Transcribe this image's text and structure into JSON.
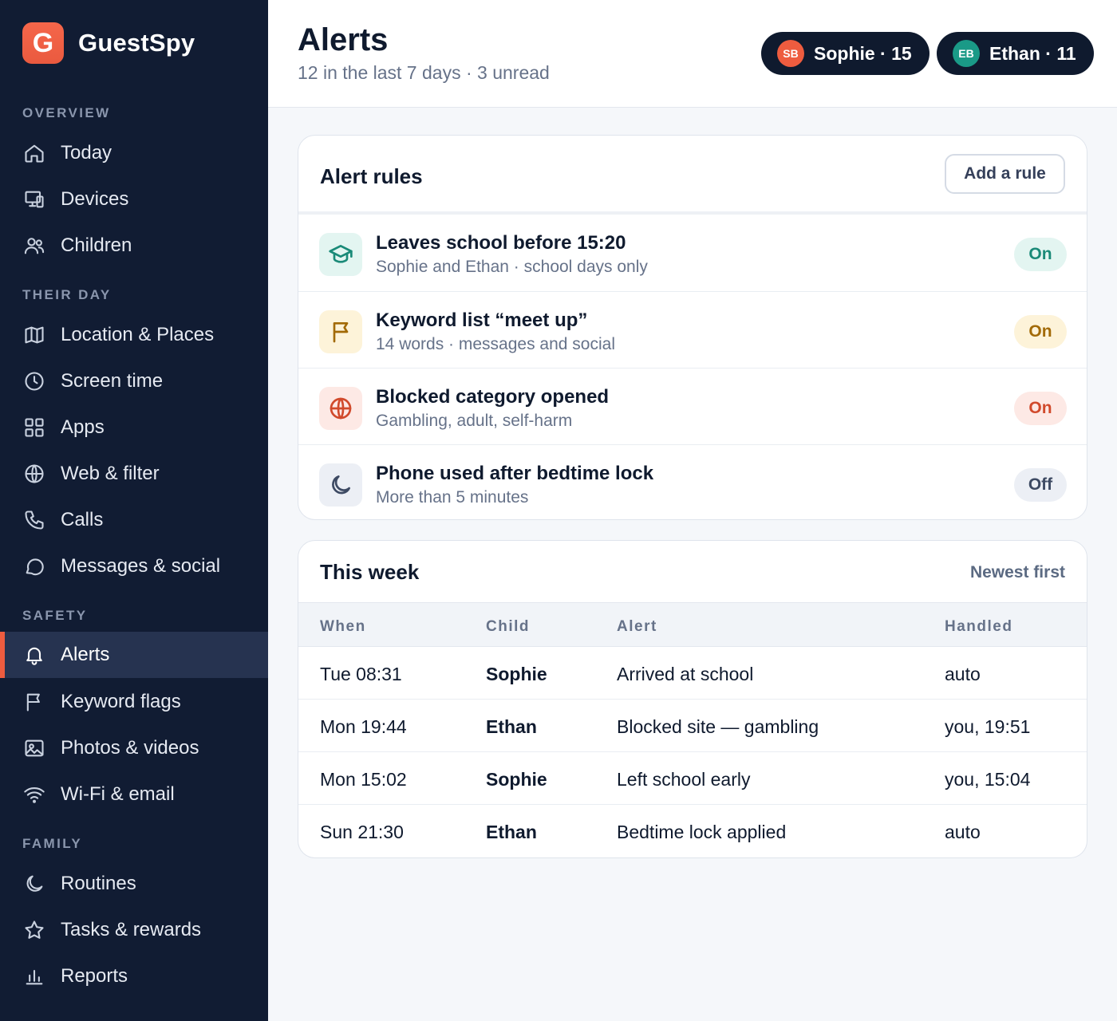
{
  "brand": {
    "logo_letter": "G",
    "name": "GuestSpy",
    "logo_color": "#ee5c3f"
  },
  "sidebar": {
    "sections": [
      {
        "label": "OVERVIEW"
      },
      {
        "label": "THEIR DAY"
      },
      {
        "label": "SAFETY"
      },
      {
        "label": "FAMILY"
      }
    ],
    "items": [
      {
        "label": "Today",
        "icon": "home-icon"
      },
      {
        "label": "Devices",
        "icon": "devices-icon"
      },
      {
        "label": "Children",
        "icon": "children-icon"
      },
      {
        "label": "Location & Places",
        "icon": "map-icon"
      },
      {
        "label": "Screen time",
        "icon": "clock-icon"
      },
      {
        "label": "Apps",
        "icon": "apps-grid-icon"
      },
      {
        "label": "Web & filter",
        "icon": "globe-icon"
      },
      {
        "label": "Calls",
        "icon": "phone-icon"
      },
      {
        "label": "Messages & social",
        "icon": "chat-bubble-icon"
      },
      {
        "label": "Alerts",
        "icon": "bell-icon",
        "active": true
      },
      {
        "label": "Keyword flags",
        "icon": "flag-icon"
      },
      {
        "label": "Photos & videos",
        "icon": "image-icon"
      },
      {
        "label": "Wi-Fi & email",
        "icon": "wifi-icon"
      },
      {
        "label": "Routines",
        "icon": "moon-icon"
      },
      {
        "label": "Tasks & rewards",
        "icon": "star-icon"
      },
      {
        "label": "Reports",
        "icon": "bar-chart-icon"
      }
    ]
  },
  "header": {
    "title": "Alerts",
    "subtitle": "12 in the last 7 days · 3 unread",
    "children": [
      {
        "initials": "SB",
        "label": "Sophie · 15",
        "color": "#ee5c3f"
      },
      {
        "initials": "EB",
        "label": "Ethan · 11",
        "color": "#1a9a87"
      }
    ]
  },
  "rules": {
    "title": "Alert rules",
    "add_label": "Add a rule",
    "items": [
      {
        "name": "Leaves school before 15:20",
        "desc": "Sophie and Ethan · school days only",
        "status": "On",
        "icon": "graduation-cap-icon"
      },
      {
        "name": "Keyword list “meet up”",
        "desc": "14 words · messages and social",
        "status": "On",
        "icon": "flag-icon"
      },
      {
        "name": "Blocked category opened",
        "desc": "Gambling, adult, self-harm",
        "status": "On",
        "icon": "globe-icon"
      },
      {
        "name": "Phone used after bedtime lock",
        "desc": "More than 5 minutes",
        "status": "Off",
        "icon": "moon-icon"
      }
    ]
  },
  "week": {
    "title": "This week",
    "sort_label": "Newest first",
    "columns": [
      "When",
      "Child",
      "Alert",
      "Handled"
    ],
    "rows": [
      [
        "Tue 08:31",
        "Sophie",
        "Arrived at school",
        "auto"
      ],
      [
        "Mon 19:44",
        "Ethan",
        "Blocked site — gambling",
        "you, 19:51"
      ],
      [
        "Mon 15:02",
        "Sophie",
        "Left school early",
        "you, 15:04"
      ],
      [
        "Sun 21:30",
        "Ethan",
        "Bedtime lock applied",
        "auto"
      ]
    ]
  }
}
